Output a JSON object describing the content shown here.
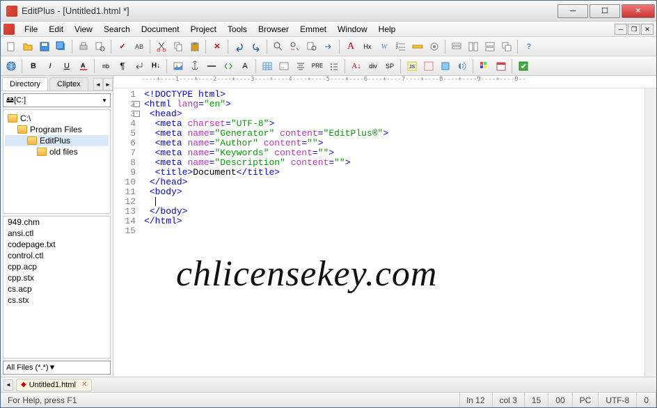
{
  "title": "EditPlus - [Untitled1.html *]",
  "menu": [
    "File",
    "Edit",
    "View",
    "Search",
    "Document",
    "Project",
    "Tools",
    "Browser",
    "Emmet",
    "Window",
    "Help"
  ],
  "sidebar": {
    "tabs": [
      "Directory",
      "Cliptex"
    ],
    "drive": "[C:]",
    "tree": [
      {
        "label": "C:\\",
        "indent": 0,
        "selected": false
      },
      {
        "label": "Program Files",
        "indent": 1,
        "selected": false
      },
      {
        "label": "EditPlus",
        "indent": 2,
        "selected": true
      },
      {
        "label": "old files",
        "indent": 3,
        "selected": false
      }
    ],
    "files": [
      "949.chm",
      "ansi.ctl",
      "codepage.txt",
      "control.ctl",
      "cpp.acp",
      "cpp.stx",
      "cs.acp",
      "cs.stx"
    ],
    "filter": "All Files (*.*)"
  },
  "ruler_text": "----+----1----+----2----+----3----+----4----+----5----+----6----+----7----+----8----+----9----+----0--",
  "code_lines": [
    {
      "n": 1,
      "fold": "",
      "html": "<span class='t-decl'>&lt;!DOCTYPE html&gt;</span>"
    },
    {
      "n": 2,
      "fold": "-",
      "html": "<span class='t-tag'>&lt;html</span> <span class='t-attr'>lang</span><span class='t-tag'>=</span><span class='t-str'>\"en\"</span><span class='t-tag'>&gt;</span>"
    },
    {
      "n": 3,
      "fold": "-",
      "html": " <span class='t-tag'>&lt;head&gt;</span>"
    },
    {
      "n": 4,
      "fold": "",
      "html": "  <span class='t-tag'>&lt;meta</span> <span class='t-attr'>charset</span><span class='t-tag'>=</span><span class='t-str'>\"UTF-8\"</span><span class='t-tag'>&gt;</span>"
    },
    {
      "n": 5,
      "fold": "",
      "html": "  <span class='t-tag'>&lt;meta</span> <span class='t-attr'>name</span><span class='t-tag'>=</span><span class='t-str'>\"Generator\"</span> <span class='t-attr'>content</span><span class='t-tag'>=</span><span class='t-str'>\"EditPlus®\"</span><span class='t-tag'>&gt;</span>"
    },
    {
      "n": 6,
      "fold": "",
      "html": "  <span class='t-tag'>&lt;meta</span> <span class='t-attr'>name</span><span class='t-tag'>=</span><span class='t-str'>\"Author\"</span> <span class='t-attr'>content</span><span class='t-tag'>=</span><span class='t-str'>\"\"</span><span class='t-tag'>&gt;</span>"
    },
    {
      "n": 7,
      "fold": "",
      "html": "  <span class='t-tag'>&lt;meta</span> <span class='t-attr'>name</span><span class='t-tag'>=</span><span class='t-str'>\"Keywords\"</span> <span class='t-attr'>content</span><span class='t-tag'>=</span><span class='t-str'>\"\"</span><span class='t-tag'>&gt;</span>"
    },
    {
      "n": 8,
      "fold": "",
      "html": "  <span class='t-tag'>&lt;meta</span> <span class='t-attr'>name</span><span class='t-tag'>=</span><span class='t-str'>\"Description\"</span> <span class='t-attr'>content</span><span class='t-tag'>=</span><span class='t-str'>\"\"</span><span class='t-tag'>&gt;</span>"
    },
    {
      "n": 9,
      "fold": "",
      "html": "  <span class='t-tag'>&lt;title&gt;</span><span class='t-text'>Document</span><span class='t-tag'>&lt;/title&gt;</span>"
    },
    {
      "n": 10,
      "fold": "",
      "html": " <span class='t-tag'>&lt;/head&gt;</span>"
    },
    {
      "n": 11,
      "fold": "",
      "html": " <span class='t-tag'>&lt;body&gt;</span>"
    },
    {
      "n": 12,
      "fold": "",
      "html": "  <span class='cursor'></span>",
      "arrow": true
    },
    {
      "n": 13,
      "fold": "",
      "html": " <span class='t-tag'>&lt;/body&gt;</span>"
    },
    {
      "n": 14,
      "fold": "",
      "html": "<span class='t-tag'>&lt;/html&gt;</span>"
    },
    {
      "n": 15,
      "fold": "",
      "html": ""
    }
  ],
  "watermark": "chlicensekey.com",
  "doc_tab": {
    "label": "Untitled1.html",
    "modified": true
  },
  "status": {
    "help": "For Help, press F1",
    "ln": "ln 12",
    "col": "col 3",
    "c3": "15",
    "c4": "00",
    "c5": "PC",
    "enc": "UTF-8",
    "c7": "0"
  },
  "toolbar2_text": {
    "B": "B",
    "I": "I",
    "U": "U",
    "nb": "nb",
    "A": "A",
    "H": "H",
    "Hx": "Hx",
    "W": "W",
    "div": "div",
    "SP": "SP",
    "PRE": "PRE"
  }
}
